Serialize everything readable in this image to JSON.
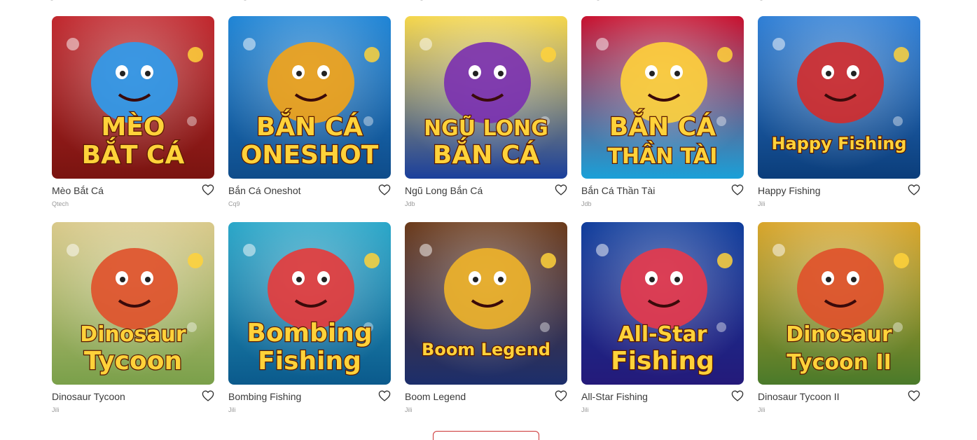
{
  "games": [
    {
      "title": "Mèo Bắt Cá",
      "provider": "Qtech",
      "art_text": [
        "MÈO",
        "BẮT CÁ"
      ],
      "palette": [
        "#7a1410",
        "#c1272d",
        "#2b9cf0"
      ],
      "icon": "cat-fish-art"
    },
    {
      "title": "Bắn Cá Oneshot",
      "provider": "Cq9",
      "art_text": [
        "BẮN CÁ",
        "ONESHOT"
      ],
      "palette": [
        "#0f4c8a",
        "#1f85d6",
        "#f4a316"
      ],
      "icon": "dragon-art"
    },
    {
      "title": "Ngũ Long Bắn Cá",
      "provider": "Jdb",
      "art_text": [
        "NGŨ LONG",
        "BẮN CÁ"
      ],
      "palette": [
        "#1a3f9c",
        "#f5d64a",
        "#7a2fb0"
      ],
      "icon": "golden-dragon-art"
    },
    {
      "title": "Bắn Cá Thần Tài",
      "provider": "Jdb",
      "art_text": [
        "BẮN CÁ",
        "THẦN TÀI"
      ],
      "palette": [
        "#1aa0d8",
        "#c8102e",
        "#ffd23a"
      ],
      "icon": "fortune-god-art"
    },
    {
      "title": "Happy Fishing",
      "provider": "Jili",
      "art_text": [
        "Happy Fishing"
      ],
      "palette": [
        "#0b3d7a",
        "#2f7fd6",
        "#d42b2b"
      ],
      "icon": "shark-art"
    },
    {
      "title": "Dinosaur Tycoon",
      "provider": "Jili",
      "art_text": [
        "Dinosaur",
        "Tycoon"
      ],
      "palette": [
        "#7aa04a",
        "#d9c98a",
        "#e0502a"
      ],
      "icon": "dinosaur-art"
    },
    {
      "title": "Bombing Fishing",
      "provider": "Jili",
      "art_text": [
        "Bombing",
        "Fishing"
      ],
      "palette": [
        "#0b5a8c",
        "#2aa7c9",
        "#e83a3a"
      ],
      "icon": "pufferfish-art"
    },
    {
      "title": "Boom Legend",
      "provider": "Jili",
      "art_text": [
        "Boom Legend"
      ],
      "palette": [
        "#1c2e6b",
        "#6b3a1a",
        "#f0b429"
      ],
      "icon": "king-art"
    },
    {
      "title": "All-Star Fishing",
      "provider": "Jili",
      "art_text": [
        "All-Star",
        "Fishing"
      ],
      "palette": [
        "#241a7a",
        "#0f3d9c",
        "#e8384a"
      ],
      "icon": "monster-art"
    },
    {
      "title": "Dinosaur Tycoon II",
      "provider": "Jili",
      "art_text": [
        "Dinosaur",
        "Tycoon II"
      ],
      "palette": [
        "#4a7a2a",
        "#d9a52a",
        "#e0502a"
      ],
      "icon": "dinosaur-ii-art"
    }
  ],
  "colors": {
    "heart": "#333333",
    "button_border": "#cc3333"
  }
}
